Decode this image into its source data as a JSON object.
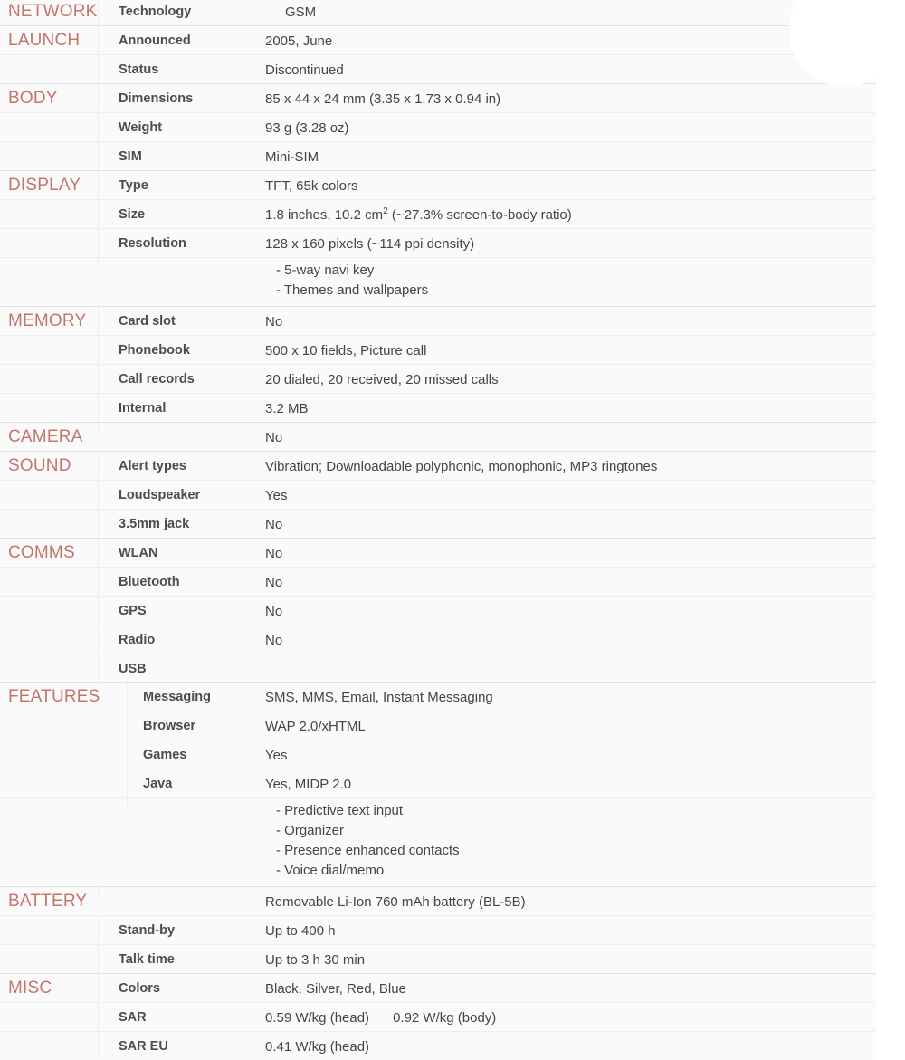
{
  "sheet": {
    "sections": [
      {
        "name": "NETWORK",
        "rows": [
          {
            "label": "Technology",
            "value": "GSM"
          }
        ]
      },
      {
        "name": "LAUNCH",
        "rows": [
          {
            "label": "Announced",
            "value": "2005, June"
          },
          {
            "label": "Status",
            "value": "Discontinued"
          }
        ]
      },
      {
        "name": "BODY",
        "rows": [
          {
            "label": "Dimensions",
            "value": "85 x 44 x 24 mm (3.35 x 1.73 x 0.94 in)"
          },
          {
            "label": "Weight",
            "value": "93 g (3.28 oz)"
          },
          {
            "label": "SIM",
            "value": "Mini-SIM"
          }
        ]
      },
      {
        "name": "DISPLAY",
        "rows": [
          {
            "label": "Type",
            "value": "TFT, 65k colors"
          },
          {
            "label": "Size",
            "value_prefix": "1.8 inches, 10.2 cm",
            "value_sup": "2",
            "value_suffix": " (~27.3% screen-to-body ratio)"
          },
          {
            "label": "Resolution",
            "value": "128 x 160 pixels (~114 ppi density)"
          },
          {
            "label": "",
            "bullets": [
              "- 5-way navi key",
              "- Themes and wallpapers"
            ]
          }
        ]
      },
      {
        "name": "MEMORY",
        "rows": [
          {
            "label": "Card slot",
            "value": "No"
          },
          {
            "label": "Phonebook",
            "value": "500 x 10 fields, Picture call"
          },
          {
            "label": "Call records",
            "value": "20 dialed, 20 received, 20 missed calls"
          },
          {
            "label": "Internal",
            "value": "3.2 MB"
          }
        ]
      },
      {
        "name": "CAMERA",
        "rows": [
          {
            "label": "",
            "value": "No"
          }
        ]
      },
      {
        "name": "SOUND",
        "rows": [
          {
            "label": "Alert types",
            "value": "Vibration; Downloadable polyphonic, monophonic, MP3 ringtones"
          },
          {
            "label": "Loudspeaker",
            "value": "Yes"
          },
          {
            "label": "3.5mm jack",
            "value": "No"
          }
        ]
      },
      {
        "name": "COMMS",
        "rows": [
          {
            "label": "WLAN",
            "value": "No"
          },
          {
            "label": "Bluetooth",
            "value": "No"
          },
          {
            "label": "GPS",
            "value": "No"
          },
          {
            "label": "Radio",
            "value": "No"
          },
          {
            "label": "USB",
            "value": ""
          }
        ]
      },
      {
        "name": "FEATURES",
        "indent": true,
        "rows": [
          {
            "label": "Messaging",
            "value": "SMS, MMS, Email, Instant Messaging"
          },
          {
            "label": "Browser",
            "value": "WAP 2.0/xHTML"
          },
          {
            "label": "Games",
            "value": "Yes"
          },
          {
            "label": "Java",
            "value": "Yes, MIDP 2.0"
          },
          {
            "label": "",
            "bullets": [
              "- Predictive text input",
              "- Organizer",
              "- Presence enhanced contacts",
              "- Voice dial/memo"
            ]
          }
        ]
      },
      {
        "name": "BATTERY",
        "rows": [
          {
            "label": "",
            "value": "Removable Li-Ion 760 mAh battery (BL-5B)"
          },
          {
            "label": "Stand-by",
            "value": "Up to 400 h"
          },
          {
            "label": "Talk time",
            "value": "Up to 3 h 30 min"
          }
        ]
      },
      {
        "name": "MISC",
        "rows": [
          {
            "label": "Colors",
            "value": "Black, Silver, Red, Blue"
          },
          {
            "label": "SAR",
            "value_a": "0.59 W/kg (head)",
            "value_b": "0.92 W/kg (body)"
          },
          {
            "label": "SAR EU",
            "value": "0.41 W/kg (head)"
          }
        ]
      }
    ]
  },
  "colors": {
    "section_heading": "#c4756b",
    "label_text": "#4c4c4c",
    "value_text": "#444444",
    "table_background": "#fafafa",
    "row_divider": "#efeeee",
    "page_background": "#ffffff"
  }
}
